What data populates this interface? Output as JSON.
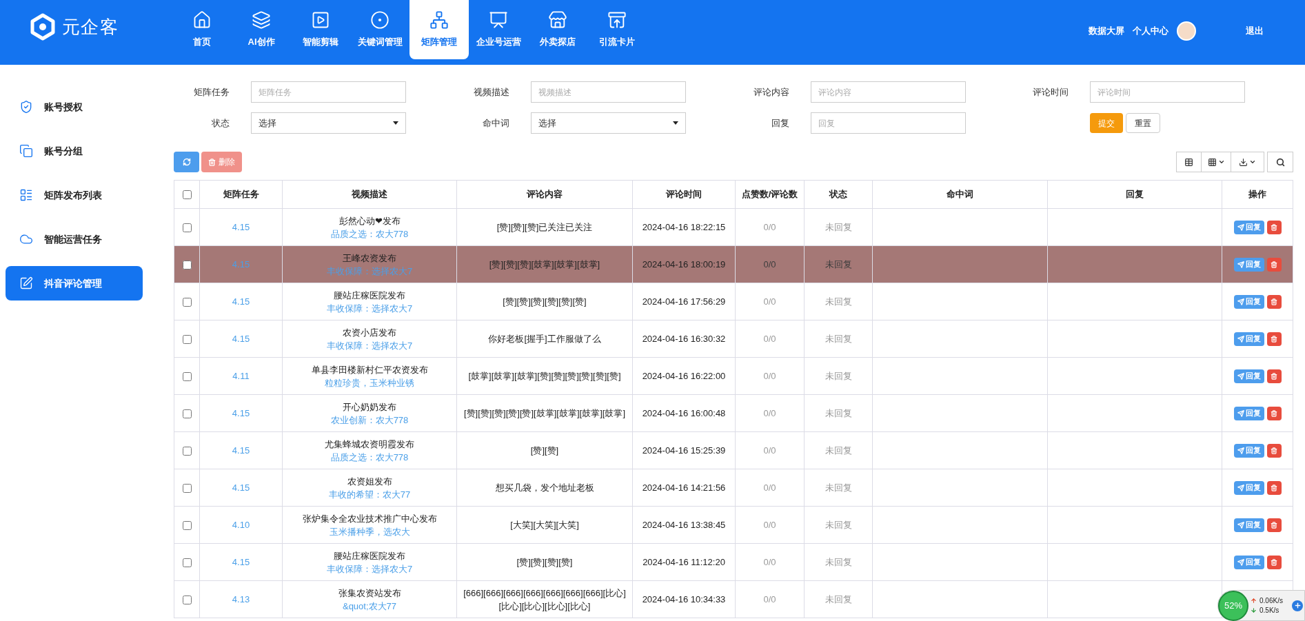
{
  "header": {
    "logo": "元企客",
    "nav": [
      {
        "label": "首页",
        "selected": false
      },
      {
        "label": "AI创作",
        "selected": false
      },
      {
        "label": "智能剪辑",
        "selected": false
      },
      {
        "label": "关键词管理",
        "selected": false
      },
      {
        "label": "矩阵管理",
        "selected": true
      },
      {
        "label": "企业号运营",
        "selected": false
      },
      {
        "label": "外卖探店",
        "selected": false
      },
      {
        "label": "引流卡片",
        "selected": false
      }
    ],
    "links": [
      "数据大屏",
      "个人中心"
    ],
    "logout": "退出"
  },
  "sidebar": {
    "items": [
      {
        "label": "账号授权",
        "selected": false
      },
      {
        "label": "账号分组",
        "selected": false
      },
      {
        "label": "矩阵发布列表",
        "selected": false
      },
      {
        "label": "智能运营任务",
        "selected": false
      },
      {
        "label": "抖音评论管理",
        "selected": true
      }
    ]
  },
  "filters": [
    {
      "label": "矩阵任务",
      "kind": "input",
      "placeholder": "矩阵任务"
    },
    {
      "label": "视频描述",
      "kind": "input",
      "placeholder": "视频描述"
    },
    {
      "label": "评论内容",
      "kind": "input",
      "placeholder": "评论内容"
    },
    {
      "label": "评论时间",
      "kind": "input",
      "placeholder": "评论时间"
    },
    {
      "label": "状态",
      "kind": "select",
      "value": "选择"
    },
    {
      "label": "命中词",
      "kind": "select",
      "value": "选择"
    },
    {
      "label": "回复",
      "kind": "input",
      "placeholder": "回复"
    }
  ],
  "filter_buttons": {
    "submit": "提交",
    "reset": "重置"
  },
  "toolbar": {
    "delete": "删除"
  },
  "table": {
    "columns": [
      "矩阵任务",
      "视频描述",
      "评论内容",
      "评论时间",
      "点赞数/评论数",
      "状态",
      "命中词",
      "回复",
      "操作"
    ],
    "select_all_checked": false,
    "rows": [
      {
        "task": "4.15",
        "title": "彭然心动❤发布",
        "subtitle": "品质之选：农大778",
        "comment": "[赞][赞][赞]已关注已关注",
        "time": "2024-04-16 18:22:15",
        "counts": "0/0",
        "status": "未回复",
        "reply": "回复",
        "selected": false,
        "checked": false
      },
      {
        "task": "4.15",
        "title": "王峰农资发布",
        "subtitle": "丰收保障：选择农大7",
        "comment": "[赞][赞][赞][鼓掌][鼓掌][鼓掌]",
        "time": "2024-04-16 18:00:19",
        "counts": "0/0",
        "status": "未回复",
        "reply": "回复",
        "selected": true,
        "checked": false
      },
      {
        "task": "4.15",
        "title": "腰站庄稼医院发布",
        "subtitle": "丰收保障：选择农大7",
        "comment": "[赞][赞][赞][赞][赞][赞]",
        "time": "2024-04-16 17:56:29",
        "counts": "0/0",
        "status": "未回复",
        "reply": "回复",
        "selected": false,
        "checked": false
      },
      {
        "task": "4.15",
        "title": "农资小店发布",
        "subtitle": "丰收保障：选择农大7",
        "comment": "你好老板[握手]工作服做了么",
        "time": "2024-04-16 16:30:32",
        "counts": "0/0",
        "status": "未回复",
        "reply": "回复",
        "selected": false,
        "checked": false
      },
      {
        "task": "4.11",
        "title": "单县李田楼新村仁平农资发布",
        "subtitle": "粒粒珍贵，玉米种业锈",
        "comment": "[鼓掌][鼓掌][鼓掌][赞][赞][赞][赞][赞][赞]",
        "time": "2024-04-16 16:22:00",
        "counts": "0/0",
        "status": "未回复",
        "reply": "回复",
        "selected": false,
        "checked": false
      },
      {
        "task": "4.15",
        "title": "开心奶奶发布",
        "subtitle": "农业创新：农大778",
        "comment": "[赞][赞][赞][赞][赞][鼓掌][鼓掌][鼓掌][鼓掌]",
        "time": "2024-04-16 16:00:48",
        "counts": "0/0",
        "status": "未回复",
        "reply": "回复",
        "selected": false,
        "checked": false
      },
      {
        "task": "4.15",
        "title": "尤集蜂城农资明霞发布",
        "subtitle": "品质之选：农大778",
        "comment": "[赞][赞]",
        "time": "2024-04-16 15:25:39",
        "counts": "0/0",
        "status": "未回复",
        "reply": "回复",
        "selected": false,
        "checked": false
      },
      {
        "task": "4.15",
        "title": "农资姐发布",
        "subtitle": "丰收的希望：农大77",
        "comment": "想买几袋，发个地址老板",
        "time": "2024-04-16 14:21:56",
        "counts": "0/0",
        "status": "未回复",
        "reply": "回复",
        "selected": false,
        "checked": false
      },
      {
        "task": "4.10",
        "title": "张炉集令全农业技术推广中心发布",
        "subtitle": "玉米播种季，选农大",
        "comment": "[大笑][大笑][大笑]",
        "time": "2024-04-16 13:38:45",
        "counts": "0/0",
        "status": "未回复",
        "reply": "回复",
        "selected": false,
        "checked": false
      },
      {
        "task": "4.15",
        "title": "腰站庄稼医院发布",
        "subtitle": "丰收保障：选择农大7",
        "comment": "[赞][赞][赞][赞]",
        "time": "2024-04-16 11:12:20",
        "counts": "0/0",
        "status": "未回复",
        "reply": "回复",
        "selected": false,
        "checked": false
      },
      {
        "task": "4.13",
        "title": "张集农资站发布",
        "subtitle": "&quot;农大77",
        "comment": "[666][666][666][666][666][666][666][比心][比心][比心][比心][比心]",
        "time": "2024-04-16 10:34:33",
        "counts": "0/0",
        "status": "未回复",
        "selected": false,
        "checked": false
      }
    ]
  },
  "net_widget": {
    "percent": "52%",
    "up": "0.06K/s",
    "down": "0.5K/s"
  }
}
